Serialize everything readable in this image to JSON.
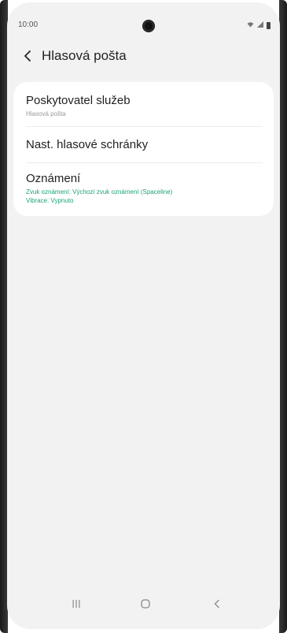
{
  "status_bar": {
    "time": "10:00"
  },
  "header": {
    "title": "Hlasová pošta"
  },
  "settings": {
    "items": [
      {
        "title": "Poskytovatel služeb",
        "subtitle": "Hlasová pošta"
      },
      {
        "title": "Nast. hlasové schránky"
      },
      {
        "title": "Oznámení",
        "line1": "Zvuk oznámení: Výchozí zvuk oznámení (Spaceline)",
        "line2": "Vibrace: Vypnuto"
      }
    ]
  },
  "colors": {
    "accent": "#1aa37a",
    "background": "#f2f2f2",
    "card": "#ffffff"
  },
  "icons": {
    "back": "chevron-left-icon",
    "recents": "recents-icon",
    "home": "home-icon",
    "nav_back": "nav-back-icon"
  }
}
